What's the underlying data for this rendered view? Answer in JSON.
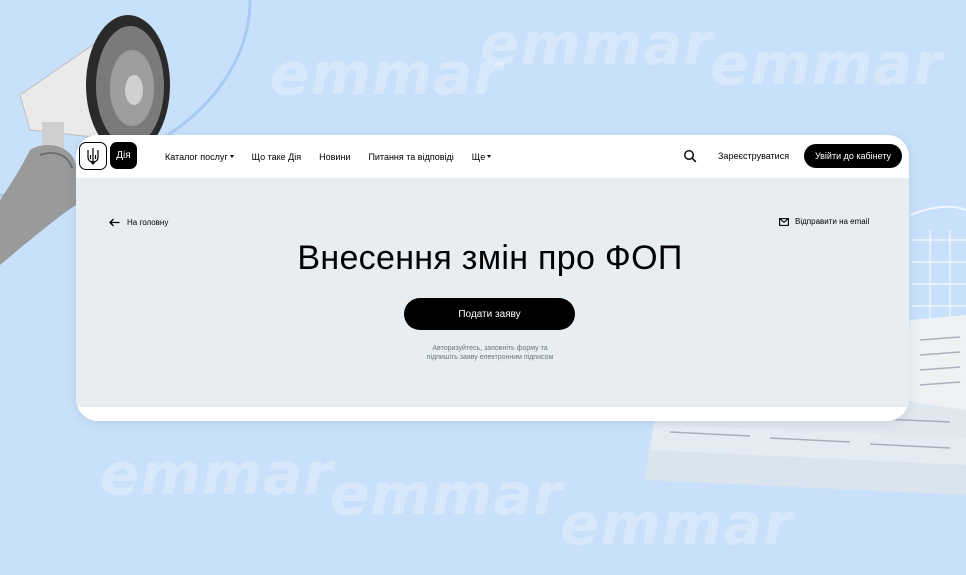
{
  "colors": {
    "background": "#c9e0fa",
    "card": "#ffffff",
    "content_panel": "#e8edf2",
    "primary_button": "#000000",
    "hint_text": "#6b7480"
  },
  "background": {
    "watermark_text": "emmar"
  },
  "header": {
    "logo_diia_label": "Дія",
    "nav": [
      {
        "label": "Каталог послуг",
        "has_dropdown": true,
        "icon": "chevron-down-icon"
      },
      {
        "label": "Що таке Дія",
        "has_dropdown": false
      },
      {
        "label": "Новини",
        "has_dropdown": false
      },
      {
        "label": "Питання та відповіді",
        "has_dropdown": false
      },
      {
        "label": "Ще",
        "has_dropdown": true,
        "icon": "chevron-down-icon"
      }
    ],
    "search_icon": "search-icon",
    "register_label": "Зареєструватися",
    "login_label": "Увійти до кабінету"
  },
  "main": {
    "back_label": "На головну",
    "back_icon": "arrow-left-icon",
    "email_label": "Відправити на email",
    "email_icon": "mail-icon",
    "title": "Внесення змін про ФОП",
    "submit_label": "Подати заяву",
    "hint_line1": "Авторизуйтесь, заповніть форму та",
    "hint_line2": "підпишіть заяву електронним підписом"
  }
}
